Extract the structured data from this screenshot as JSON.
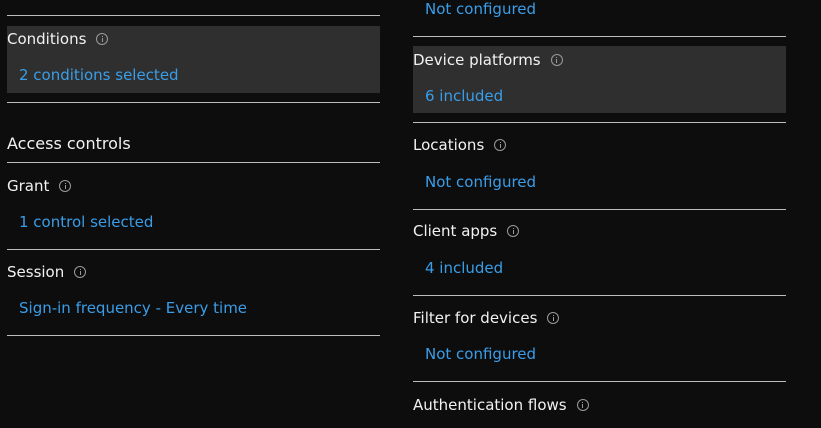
{
  "left": {
    "conditions": {
      "label": "Conditions",
      "value": "2 conditions selected"
    },
    "access_controls_heading": "Access controls",
    "grant": {
      "label": "Grant",
      "value": "1 control selected"
    },
    "session": {
      "label": "Session",
      "value": "Sign-in frequency - Every time"
    }
  },
  "right": {
    "top_value": "Not configured",
    "device_platforms": {
      "label": "Device platforms",
      "value": "6 included"
    },
    "locations": {
      "label": "Locations",
      "value": "Not configured"
    },
    "client_apps": {
      "label": "Client apps",
      "value": "4 included"
    },
    "filter_for_devices": {
      "label": "Filter for devices",
      "value": "Not configured"
    },
    "authentication_flows": {
      "label": "Authentication flows"
    }
  },
  "colors": {
    "link": "#3a9de8",
    "highlight": "#2f2f2f",
    "background": "#0d0d0d"
  }
}
